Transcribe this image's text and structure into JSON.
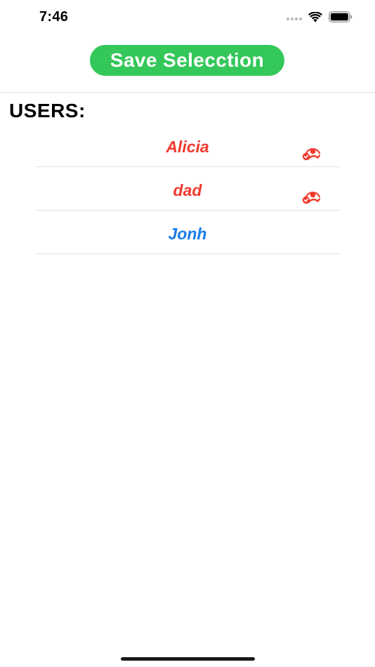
{
  "status_bar": {
    "time": "7:46",
    "icons": [
      "signal-dots-icon",
      "wifi-icon",
      "battery-icon"
    ]
  },
  "header": {
    "save_label": "Save Selecction",
    "save_color": "#34c759"
  },
  "section_title": "USERS:",
  "users": [
    {
      "name": "Alicia",
      "selected": true
    },
    {
      "name": "dad",
      "selected": true
    },
    {
      "name": "Jonh",
      "selected": false
    }
  ],
  "colors": {
    "selected_text": "#f23a2f",
    "unselected_text": "#1a7ce8",
    "check_icon": "#f23a2f"
  }
}
